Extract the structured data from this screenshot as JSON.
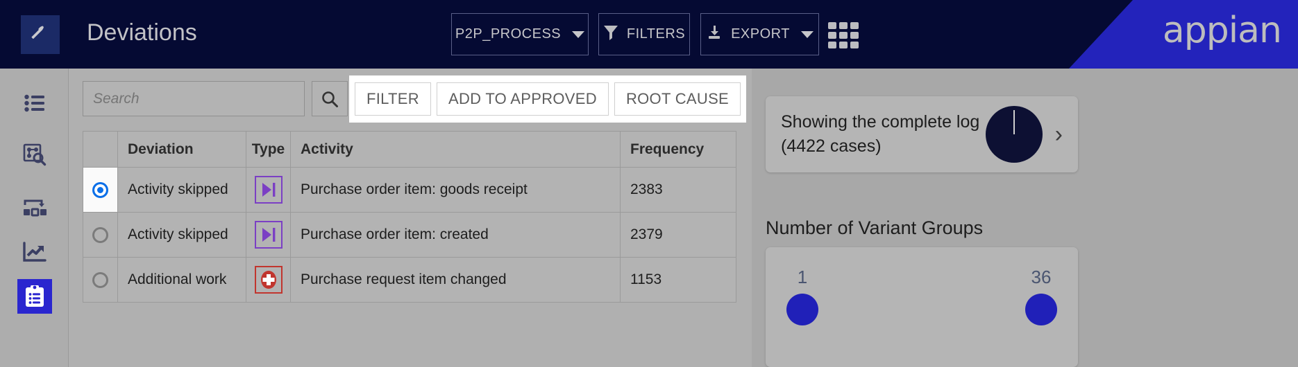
{
  "header": {
    "app_icon": "hammer-pick-icon",
    "title": "Deviations",
    "process_selector": {
      "label": "P2P_PROCESS",
      "icon": "chevron-down-icon"
    },
    "filters_button": {
      "label": "FILTERS",
      "icon": "funnel-icon"
    },
    "export_button": {
      "label": "EXPORT",
      "icon": "download-icon",
      "caret": "chevron-down-icon"
    },
    "apps_grid_icon": "grid-apps-icon",
    "brand": "appian",
    "brand_color": "#2323bb",
    "bar_color": "#050a33"
  },
  "sidebar": {
    "items": [
      {
        "name": "sidebar-item-list",
        "icon": "bulleted-list-icon",
        "active": false
      },
      {
        "name": "sidebar-item-process-explorer",
        "icon": "process-search-icon",
        "active": false
      },
      {
        "name": "sidebar-item-process-flow",
        "icon": "process-flow-icon",
        "active": false
      },
      {
        "name": "sidebar-item-analytics",
        "icon": "trend-chart-icon",
        "active": false
      },
      {
        "name": "sidebar-item-deviations",
        "icon": "clipboard-list-icon",
        "active": true
      }
    ],
    "active_color": "#2a26cf"
  },
  "toolbar": {
    "search": {
      "placeholder": "Search",
      "value": ""
    },
    "search_icon": "magnifier-icon",
    "actions": [
      {
        "label": "FILTER",
        "name": "filter-button"
      },
      {
        "label": "ADD TO APPROVED",
        "name": "add-to-approved-button"
      },
      {
        "label": "ROOT CAUSE",
        "name": "root-cause-button"
      }
    ]
  },
  "table": {
    "columns": [
      "",
      "Deviation",
      "Type",
      "Activity",
      "Frequency"
    ],
    "rows": [
      {
        "selected": true,
        "deviation": "Activity skipped",
        "type_icon": "skip-forward-icon",
        "type_style": "skip",
        "activity": "Purchase order item: goods receipt",
        "frequency": "2383"
      },
      {
        "selected": false,
        "deviation": "Activity skipped",
        "type_icon": "skip-forward-icon",
        "type_style": "skip",
        "activity": "Purchase order item: created",
        "frequency": "2379"
      },
      {
        "selected": false,
        "deviation": "Additional work",
        "type_icon": "plus-circle-icon",
        "type_style": "addw",
        "activity": "Purchase request item changed",
        "frequency": "1153"
      }
    ]
  },
  "right_panel": {
    "log_card": {
      "text": "Showing the complete log (4422 cases)",
      "donut_icon": "donut-chart-icon",
      "chevron": "›"
    },
    "variant_groups_title": "Number of Variant Groups",
    "variant_groups": [
      {
        "value": "1"
      },
      {
        "value": "36"
      }
    ]
  }
}
